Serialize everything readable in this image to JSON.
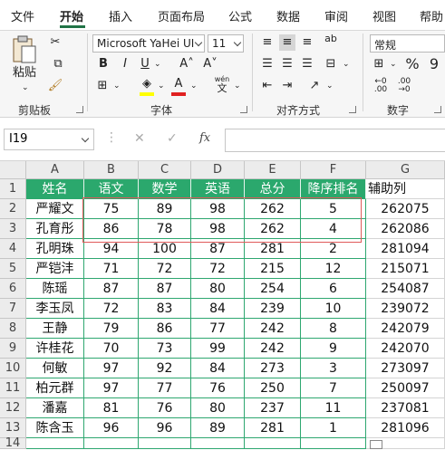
{
  "menu": {
    "tabs": [
      "文件",
      "开始",
      "插入",
      "页面布局",
      "公式",
      "数据",
      "审阅",
      "视图",
      "帮助"
    ],
    "active_tab": "开始"
  },
  "ribbon": {
    "clipboard": {
      "label": "剪贴板",
      "paste": "粘贴"
    },
    "font": {
      "label": "字体",
      "font_name": "Microsoft YaHei UI",
      "font_size": "11",
      "bold": "B",
      "italic": "I",
      "underline": "U",
      "grow": "A˄",
      "shrink": "A˅",
      "font_color_glyph": "A",
      "wen_top": "wén",
      "wen_bottom": "文"
    },
    "alignment": {
      "label": "对齐方式",
      "wrap": "ab"
    },
    "number": {
      "label": "数字",
      "format": "常规",
      "percent": "%",
      "comma": "9"
    }
  },
  "formula_bar": {
    "name_box": "I19",
    "fx": "fx",
    "cancel": "✕",
    "enter": "✓",
    "value": ""
  },
  "sheet": {
    "columns": [
      "A",
      "B",
      "C",
      "D",
      "E",
      "F",
      "G"
    ],
    "row_numbers": [
      "1",
      "2",
      "3",
      "4",
      "5",
      "6",
      "7",
      "8",
      "9",
      "10",
      "11",
      "12",
      "13",
      "14"
    ],
    "header": [
      "姓名",
      "语文",
      "数学",
      "英语",
      "总分",
      "降序排名",
      "辅助列"
    ],
    "rows": [
      [
        "严耀文",
        "75",
        "89",
        "98",
        "262",
        "5",
        "262075"
      ],
      [
        "孔育彤",
        "86",
        "78",
        "98",
        "262",
        "4",
        "262086"
      ],
      [
        "孔明珠",
        "94",
        "100",
        "87",
        "281",
        "2",
        "281094"
      ],
      [
        "严铠沣",
        "71",
        "72",
        "72",
        "215",
        "12",
        "215071"
      ],
      [
        "陈瑶",
        "87",
        "87",
        "80",
        "254",
        "6",
        "254087"
      ],
      [
        "李玉凤",
        "72",
        "83",
        "84",
        "239",
        "10",
        "239072"
      ],
      [
        "王静",
        "79",
        "86",
        "77",
        "242",
        "8",
        "242079"
      ],
      [
        "许桂花",
        "70",
        "73",
        "99",
        "242",
        "9",
        "242070"
      ],
      [
        "何敏",
        "97",
        "92",
        "84",
        "273",
        "3",
        "273097"
      ],
      [
        "柏元群",
        "97",
        "77",
        "76",
        "250",
        "7",
        "250097"
      ],
      [
        "潘嘉",
        "81",
        "76",
        "80",
        "237",
        "11",
        "237081"
      ],
      [
        "陈含玉",
        "96",
        "96",
        "89",
        "281",
        "1",
        "281096"
      ]
    ]
  },
  "colors": {
    "accent": "#217346",
    "header_fill": "#2ba86d",
    "grid_border": "#2ea770",
    "highlight_box": "#e05a5a"
  }
}
